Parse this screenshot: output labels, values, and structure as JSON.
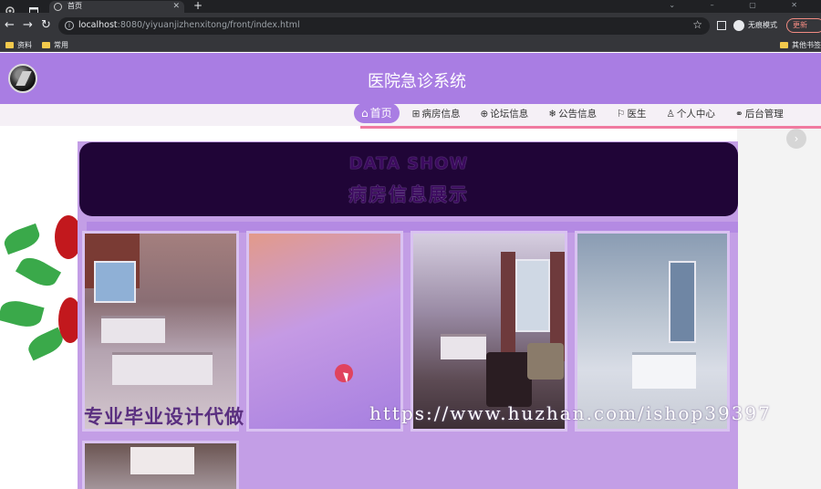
{
  "browser": {
    "tab_title": "首页",
    "new_tab": "+",
    "url_host": "localhost",
    "url_rest": ":8080/yiyuanjizhenxitong/front/index.html",
    "profile_label": "无痕模式",
    "update_label": "更新",
    "bookmarks": [
      "资料",
      "常用"
    ],
    "bookmarks_right": "其他书签"
  },
  "site": {
    "title": "医院急诊系统",
    "nav": [
      {
        "icon": "home-icon",
        "glyph": "⌂",
        "label": "首页"
      },
      {
        "icon": "bed-icon",
        "glyph": "⊞",
        "label": "病房信息"
      },
      {
        "icon": "forum-icon",
        "glyph": "⊕",
        "label": "论坛信息"
      },
      {
        "icon": "notice-icon",
        "glyph": "❄",
        "label": "公告信息"
      },
      {
        "icon": "flag-icon",
        "glyph": "⚐",
        "label": "医生"
      },
      {
        "icon": "user-icon",
        "glyph": "♙",
        "label": "个人中心"
      },
      {
        "icon": "link-icon",
        "glyph": "⚭",
        "label": "后台管理"
      }
    ]
  },
  "showcase": {
    "heading_en": "DATA SHOW",
    "heading_cn": "病房信息展示"
  },
  "watermarks": {
    "promo": "专业毕业设计代做",
    "url": "https://www.huzhan.com/ishop39397"
  },
  "colors": {
    "accent": "#a97de3",
    "banner": "#200537",
    "nav_underline": "#f07aa0"
  }
}
